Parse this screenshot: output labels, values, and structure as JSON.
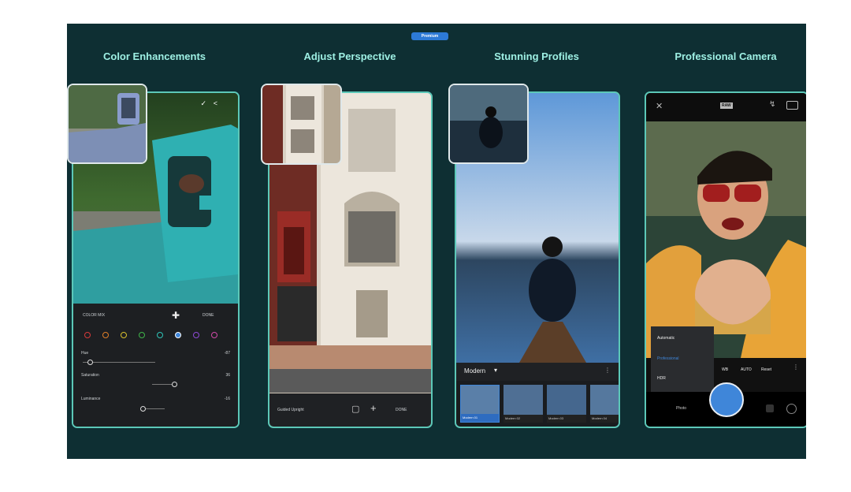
{
  "badge": "Premium",
  "panels": [
    {
      "title": "Color Enhancements",
      "mix_label": "COLOR MIX",
      "done_label": "DONE",
      "sliders": [
        {
          "label": "Hue",
          "value": "-87"
        },
        {
          "label": "Saturation",
          "value": "36"
        },
        {
          "label": "Luminance",
          "value": "-16"
        }
      ]
    },
    {
      "title": "Adjust Perspective",
      "mode_label": "Guided Upright",
      "done_label": "DONE"
    },
    {
      "title": "Stunning Profiles",
      "profile_group": "Modern",
      "profiles": [
        "Modern 01",
        "Modern 02",
        "Modern 03",
        "Modern 04"
      ]
    },
    {
      "title": "Professional Camera",
      "status_label": "RAW",
      "modes": [
        "Automatic",
        "Professional",
        "HDR"
      ],
      "controls": [
        "WB",
        "AUTO",
        "Reset"
      ],
      "photo_label": "Photo"
    }
  ],
  "colors": {
    "background": "#0e2f33",
    "title": "#9ef0e4",
    "frame": "#5cc8b8",
    "badge": "#2d7ad6",
    "shutter": "#3f86d9"
  }
}
